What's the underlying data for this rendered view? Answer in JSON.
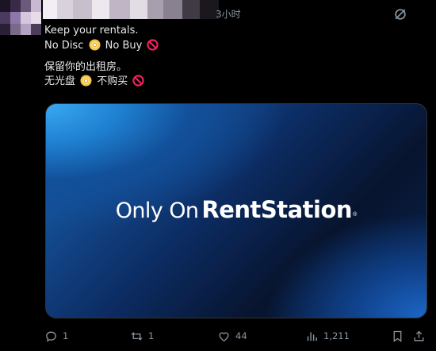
{
  "post": {
    "timestamp": "3小时",
    "lines": {
      "l1": "Keep your rentals.",
      "l2_a": "No Disc",
      "l2_b": "No Buy",
      "l3": "保留你的出租房。",
      "l4_a": "无光盘",
      "l4_b": "不购买"
    },
    "media": {
      "headline_prefix": "Only On",
      "headline_brand": "RentStation",
      "registered_mark": "®"
    },
    "actions": {
      "replies": "1",
      "reposts": "1",
      "likes": "44",
      "views": "1,211"
    }
  },
  "icons": {
    "header": "grok-icon",
    "disc": "optical-disc-emoji",
    "prohibited": "prohibited-emoji",
    "reply": "reply-icon",
    "repost": "repost-icon",
    "like": "heart-icon",
    "views": "views-chart-icon",
    "bookmark": "bookmark-icon",
    "share": "share-icon"
  },
  "colors": {
    "background": "#000000",
    "text": "#e7e9ea",
    "muted": "#8b98a5",
    "prohibited": "#f4245e",
    "disc": "#f5c542"
  }
}
